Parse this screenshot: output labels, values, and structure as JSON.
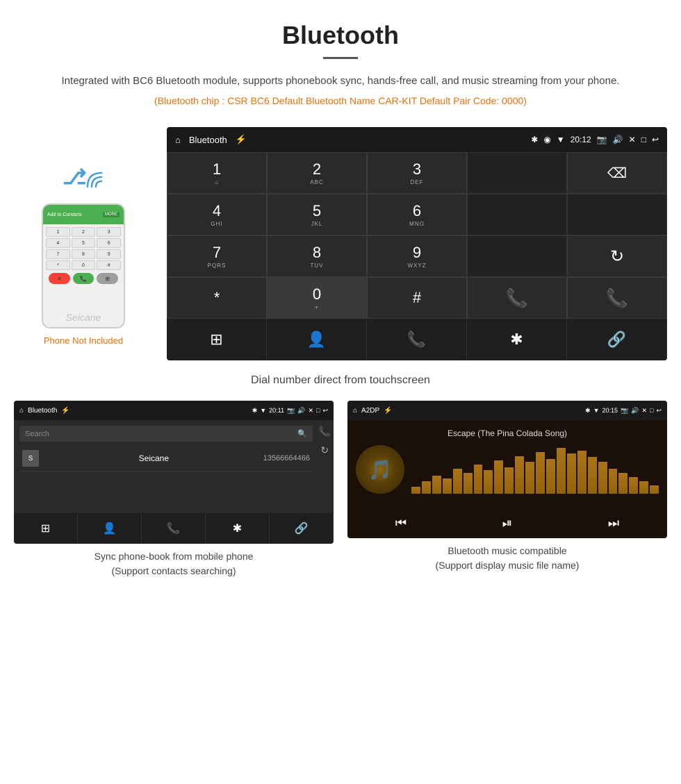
{
  "header": {
    "title": "Bluetooth",
    "description": "Integrated with BC6 Bluetooth module, supports phonebook sync, hands-free call, and music streaming from your phone.",
    "specs": "(Bluetooth chip : CSR BC6    Default Bluetooth Name CAR-KIT    Default Pair Code: 0000)"
  },
  "phone_section": {
    "not_included_label": "Phone Not Included"
  },
  "large_screen": {
    "status_bar": {
      "app_name": "Bluetooth",
      "time": "20:12",
      "usb_icon": "⚡"
    },
    "caption": "Dial number direct from touchscreen",
    "dialpad": {
      "keys": [
        {
          "label": "1",
          "sub": "⌂"
        },
        {
          "label": "2",
          "sub": "ABC"
        },
        {
          "label": "3",
          "sub": "DEF"
        },
        {
          "label": "",
          "sub": ""
        },
        {
          "label": "⌫",
          "sub": ""
        },
        {
          "label": "4",
          "sub": "GHI"
        },
        {
          "label": "5",
          "sub": "JKL"
        },
        {
          "label": "6",
          "sub": "MNO"
        },
        {
          "label": "",
          "sub": ""
        },
        {
          "label": "",
          "sub": ""
        },
        {
          "label": "7",
          "sub": "PQRS"
        },
        {
          "label": "8",
          "sub": "TUV"
        },
        {
          "label": "9",
          "sub": "WXYZ"
        },
        {
          "label": "",
          "sub": ""
        },
        {
          "label": "↻",
          "sub": ""
        },
        {
          "label": "*",
          "sub": ""
        },
        {
          "label": "0",
          "sub": "+"
        },
        {
          "label": "#",
          "sub": ""
        },
        {
          "label": "📞",
          "sub": ""
        },
        {
          "label": "📞",
          "sub": "end"
        }
      ]
    },
    "nav": {
      "items": [
        "⊞",
        "👤",
        "📞",
        "✱",
        "🔗"
      ]
    }
  },
  "phonebook_screen": {
    "status_bar": {
      "app_name": "Bluetooth",
      "time": "20:11"
    },
    "search_placeholder": "Search",
    "contacts": [
      {
        "initial": "S",
        "name": "Seicane",
        "number": "13566664466"
      }
    ],
    "caption_line1": "Sync phone-book from mobile phone",
    "caption_line2": "(Support contacts searching)"
  },
  "music_screen": {
    "status_bar": {
      "app_name": "A2DP",
      "time": "20:15"
    },
    "song_title": "Escape (The Pina Colada Song)",
    "viz_bars": [
      8,
      15,
      22,
      18,
      30,
      25,
      35,
      28,
      40,
      32,
      45,
      38,
      50,
      42,
      55,
      48,
      52,
      44,
      38,
      30,
      25,
      20,
      15,
      10
    ],
    "caption_line1": "Bluetooth music compatible",
    "caption_line2": "(Support display music file name)"
  },
  "icons": {
    "home": "⌂",
    "bluetooth_char": "ʙ",
    "search_icon": "🔍",
    "call_icon": "📞",
    "sync_icon": "↻",
    "grid_icon": "⊞",
    "person_icon": "👤",
    "bluetooth_icon": "✱",
    "link_icon": "🔗",
    "prev_icon": "⏮",
    "play_icon": "⏯",
    "next_icon": "⏭"
  }
}
